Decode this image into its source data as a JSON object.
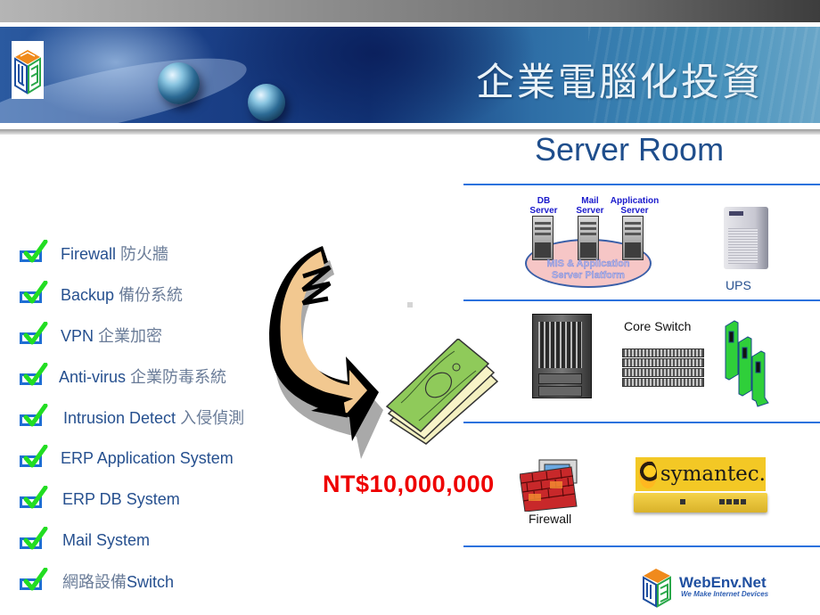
{
  "header": {
    "title": "企業電腦化投資"
  },
  "heading": "Server Room",
  "checklist": [
    {
      "en": "Firewall",
      "zh": "防火牆",
      "checked": true
    },
    {
      "en": "Backup",
      "zh": "備份系統",
      "checked": true
    },
    {
      "en": "VPN",
      "zh": "企業加密",
      "checked": true
    },
    {
      "en": "Anti-virus",
      "zh": "企業防毒系統",
      "checked": true
    },
    {
      "en": "Intrusion Detect",
      "zh": "入侵偵測",
      "checked": true
    },
    {
      "en": "ERP Application System",
      "zh": "",
      "checked": true
    },
    {
      "en": "ERP DB System",
      "zh": "",
      "checked": true
    },
    {
      "en": "Mail System",
      "zh": "",
      "checked": true
    },
    {
      "en": "Switch",
      "zh": "網路設備",
      "zh_first": true,
      "checked": true
    }
  ],
  "price": "NT$10,000,000",
  "servers": {
    "db": [
      "DB",
      "Server"
    ],
    "mail": [
      "Mail",
      "Server"
    ],
    "app": [
      "Application",
      "Server"
    ],
    "platform": [
      "MIS & Application",
      "Server Platform"
    ]
  },
  "ups_label": "UPS",
  "core_switch_label": "Core Switch",
  "firewall_label": "Firewall",
  "symantec_brand": "symantec.",
  "footer": {
    "brand": "WebEnv.Net",
    "tagline": "We Make Internet Devices"
  },
  "colors": {
    "accent_blue": "#2c72dd",
    "text_blue": "#26508f",
    "price_red": "#ee0000",
    "check_green": "#22dd22"
  }
}
